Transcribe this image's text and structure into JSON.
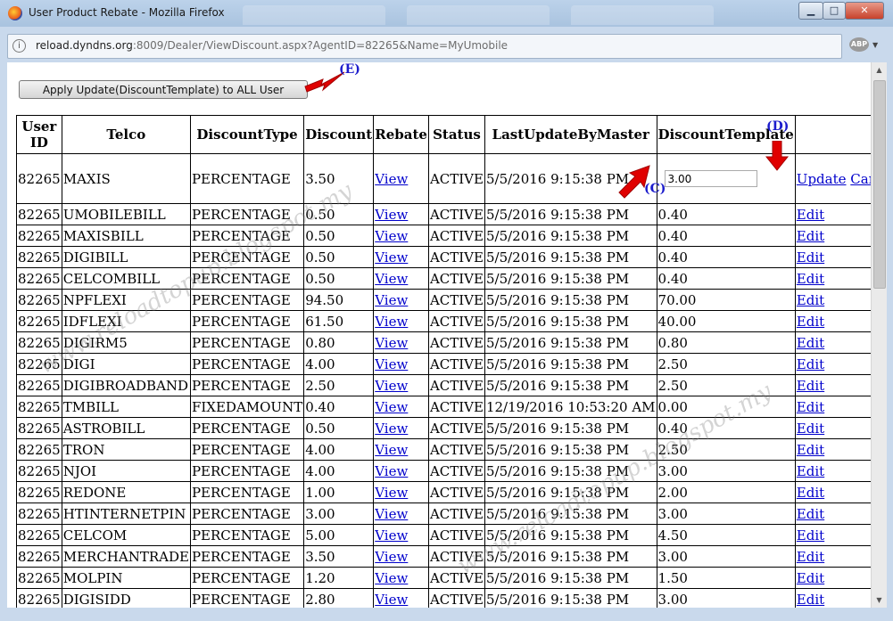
{
  "window": {
    "title": "User Product Rebate - Mozilla Firefox",
    "url_host": "reload.dyndns.org",
    "url_rest": ":8009/Dealer/ViewDiscount.aspx?AgentID=82265&Name=MyUmobile",
    "info_icon": "i",
    "abp_label": "ABP",
    "controls": {
      "minimize": "▁",
      "maximize": "□",
      "close": "✕"
    }
  },
  "apply_button_label": "Apply Update(DiscountTemplate) to ALL User",
  "annotations": {
    "e": "(E)",
    "d": "(D)",
    "c": "(C)"
  },
  "watermark": "www.reloadtopup.blogspot.my",
  "table": {
    "headers": {
      "userid": "User ID",
      "telco": "Telco",
      "discounttype": "DiscountType",
      "discount": "Discount",
      "rebate": "Rebate",
      "status": "Status",
      "lastupdate": "LastUpdateByMaster",
      "template": "DiscountTemplate",
      "action": ""
    },
    "editing_row": {
      "userid": "82265",
      "telco": "MAXIS",
      "discounttype": "PERCENTAGE",
      "discount": "3.50",
      "rebate": "View",
      "status": "ACTIVE",
      "lastupdate": "5/5/2016 9:15:38 PM",
      "template_input": "3.00",
      "update_link": "Update",
      "cancel_link": "Cancel"
    },
    "rows": [
      {
        "userid": "82265",
        "telco": "UMOBILEBILL",
        "discounttype": "PERCENTAGE",
        "discount": "0.50",
        "rebate": "View",
        "status": "ACTIVE",
        "lastupdate": "5/5/2016 9:15:38 PM",
        "template": "0.40",
        "action": "Edit"
      },
      {
        "userid": "82265",
        "telco": "MAXISBILL",
        "discounttype": "PERCENTAGE",
        "discount": "0.50",
        "rebate": "View",
        "status": "ACTIVE",
        "lastupdate": "5/5/2016 9:15:38 PM",
        "template": "0.40",
        "action": "Edit"
      },
      {
        "userid": "82265",
        "telco": "DIGIBILL",
        "discounttype": "PERCENTAGE",
        "discount": "0.50",
        "rebate": "View",
        "status": "ACTIVE",
        "lastupdate": "5/5/2016 9:15:38 PM",
        "template": "0.40",
        "action": "Edit"
      },
      {
        "userid": "82265",
        "telco": "CELCOMBILL",
        "discounttype": "PERCENTAGE",
        "discount": "0.50",
        "rebate": "View",
        "status": "ACTIVE",
        "lastupdate": "5/5/2016 9:15:38 PM",
        "template": "0.40",
        "action": "Edit"
      },
      {
        "userid": "82265",
        "telco": "NPFLEXI",
        "discounttype": "PERCENTAGE",
        "discount": "94.50",
        "rebate": "View",
        "status": "ACTIVE",
        "lastupdate": "5/5/2016 9:15:38 PM",
        "template": "70.00",
        "action": "Edit"
      },
      {
        "userid": "82265",
        "telco": "IDFLEXI",
        "discounttype": "PERCENTAGE",
        "discount": "61.50",
        "rebate": "View",
        "status": "ACTIVE",
        "lastupdate": "5/5/2016 9:15:38 PM",
        "template": "40.00",
        "action": "Edit"
      },
      {
        "userid": "82265",
        "telco": "DIGIRM5",
        "discounttype": "PERCENTAGE",
        "discount": "0.80",
        "rebate": "View",
        "status": "ACTIVE",
        "lastupdate": "5/5/2016 9:15:38 PM",
        "template": "0.80",
        "action": "Edit"
      },
      {
        "userid": "82265",
        "telco": "DIGI",
        "discounttype": "PERCENTAGE",
        "discount": "4.00",
        "rebate": "View",
        "status": "ACTIVE",
        "lastupdate": "5/5/2016 9:15:38 PM",
        "template": "2.50",
        "action": "Edit"
      },
      {
        "userid": "82265",
        "telco": "DIGIBROADBAND",
        "discounttype": "PERCENTAGE",
        "discount": "2.50",
        "rebate": "View",
        "status": "ACTIVE",
        "lastupdate": "5/5/2016 9:15:38 PM",
        "template": "2.50",
        "action": "Edit"
      },
      {
        "userid": "82265",
        "telco": "TMBILL",
        "discounttype": "FIXEDAMOUNT",
        "discount": "0.40",
        "rebate": "View",
        "status": "ACTIVE",
        "lastupdate": "12/19/2016 10:53:20 AM",
        "template": "0.00",
        "action": "Edit"
      },
      {
        "userid": "82265",
        "telco": "ASTROBILL",
        "discounttype": "PERCENTAGE",
        "discount": "0.50",
        "rebate": "View",
        "status": "ACTIVE",
        "lastupdate": "5/5/2016 9:15:38 PM",
        "template": "0.40",
        "action": "Edit"
      },
      {
        "userid": "82265",
        "telco": "TRON",
        "discounttype": "PERCENTAGE",
        "discount": "4.00",
        "rebate": "View",
        "status": "ACTIVE",
        "lastupdate": "5/5/2016 9:15:38 PM",
        "template": "2.50",
        "action": "Edit"
      },
      {
        "userid": "82265",
        "telco": "NJOI",
        "discounttype": "PERCENTAGE",
        "discount": "4.00",
        "rebate": "View",
        "status": "ACTIVE",
        "lastupdate": "5/5/2016 9:15:38 PM",
        "template": "3.00",
        "action": "Edit"
      },
      {
        "userid": "82265",
        "telco": "REDONE",
        "discounttype": "PERCENTAGE",
        "discount": "1.00",
        "rebate": "View",
        "status": "ACTIVE",
        "lastupdate": "5/5/2016 9:15:38 PM",
        "template": "2.00",
        "action": "Edit"
      },
      {
        "userid": "82265",
        "telco": "HTINTERNETPIN",
        "discounttype": "PERCENTAGE",
        "discount": "3.00",
        "rebate": "View",
        "status": "ACTIVE",
        "lastupdate": "5/5/2016 9:15:38 PM",
        "template": "3.00",
        "action": "Edit"
      },
      {
        "userid": "82265",
        "telco": "CELCOM",
        "discounttype": "PERCENTAGE",
        "discount": "5.00",
        "rebate": "View",
        "status": "ACTIVE",
        "lastupdate": "5/5/2016 9:15:38 PM",
        "template": "4.50",
        "action": "Edit"
      },
      {
        "userid": "82265",
        "telco": "MERCHANTRADE",
        "discounttype": "PERCENTAGE",
        "discount": "3.50",
        "rebate": "View",
        "status": "ACTIVE",
        "lastupdate": "5/5/2016 9:15:38 PM",
        "template": "3.00",
        "action": "Edit"
      },
      {
        "userid": "82265",
        "telco": "MOLPIN",
        "discounttype": "PERCENTAGE",
        "discount": "1.20",
        "rebate": "View",
        "status": "ACTIVE",
        "lastupdate": "5/5/2016 9:15:38 PM",
        "template": "1.50",
        "action": "Edit"
      },
      {
        "userid": "82265",
        "telco": "DIGISIDD",
        "discounttype": "PERCENTAGE",
        "discount": "2.80",
        "rebate": "View",
        "status": "ACTIVE",
        "lastupdate": "5/5/2016 9:15:38 PM",
        "template": "3.00",
        "action": "Edit"
      }
    ]
  }
}
